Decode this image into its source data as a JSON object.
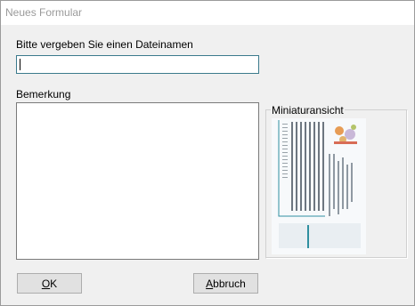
{
  "window": {
    "title": "Neues Formular"
  },
  "form": {
    "filename_label": "Bitte vergeben Sie einen Dateinamen",
    "filename_value": "",
    "remark_label": "Bemerkung",
    "remark_value": "",
    "thumbnail_label": "Miniaturansicht"
  },
  "buttons": {
    "ok_mnemonic": "O",
    "ok_rest": "K",
    "cancel_mnemonic": "A",
    "cancel_rest": "bbruch"
  },
  "colors": {
    "dialog_bg": "#f0f0f0",
    "title_text": "#9a9a9a",
    "focus_border": "#3b7a8c",
    "thumb_teal": "#2f8fa0",
    "thumb_orange": "#e79c55"
  }
}
